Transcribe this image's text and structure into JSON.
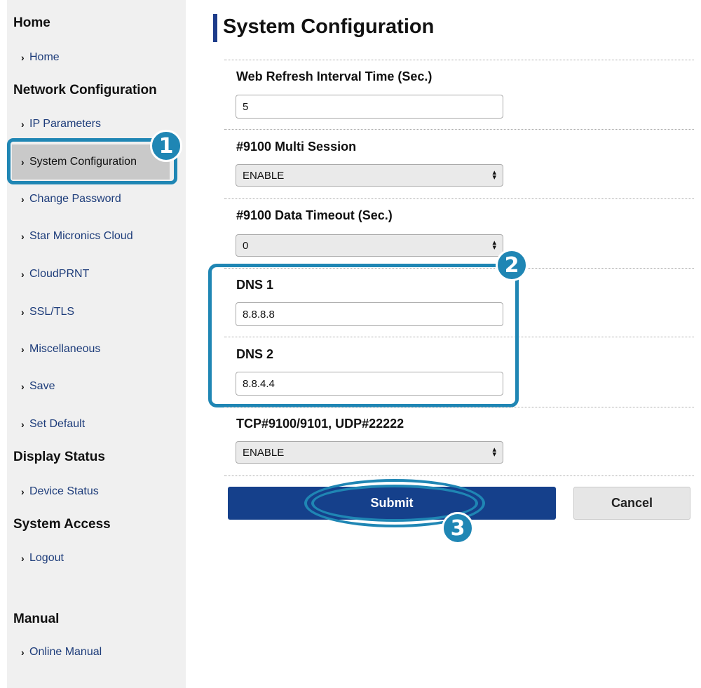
{
  "sidebar": {
    "sections": [
      {
        "heading": "Home",
        "items": [
          {
            "label": "Home"
          }
        ]
      },
      {
        "heading": "Network Configuration",
        "items": [
          {
            "label": "IP Parameters"
          },
          {
            "label": "System Configuration"
          },
          {
            "label": "Change Password"
          },
          {
            "label": "Star Micronics Cloud"
          },
          {
            "label": "CloudPRNT"
          },
          {
            "label": "SSL/TLS"
          },
          {
            "label": "Miscellaneous"
          },
          {
            "label": "Save"
          },
          {
            "label": "Set Default"
          }
        ]
      },
      {
        "heading": "Display Status",
        "items": [
          {
            "label": "Device Status"
          }
        ]
      },
      {
        "heading": "System Access",
        "items": [
          {
            "label": "Logout"
          }
        ]
      },
      {
        "heading": "Manual",
        "items": [
          {
            "label": "Online Manual"
          }
        ]
      }
    ],
    "active_item": "System Configuration"
  },
  "main": {
    "title": "System Configuration",
    "fields": [
      {
        "label": "Web Refresh Interval Time (Sec.)",
        "type": "input",
        "value": "5"
      },
      {
        "label": "#9100 Multi Session",
        "type": "select",
        "value": "ENABLE"
      },
      {
        "label": "#9100 Data Timeout (Sec.)",
        "type": "select",
        "value": "0"
      },
      {
        "label": "DNS 1",
        "type": "input",
        "value": "8.8.8.8"
      },
      {
        "label": "DNS 2",
        "type": "input",
        "value": "8.8.4.4"
      },
      {
        "label": "TCP#9100/9101, UDP#22222",
        "type": "select",
        "value": "ENABLE"
      }
    ],
    "submit_label": "Submit",
    "cancel_label": "Cancel"
  },
  "annotations": {
    "step1": "1",
    "step2": "2",
    "step3": "3",
    "color": "#1f86b4"
  },
  "colors": {
    "primary_button": "#15408b",
    "sidebar_bg": "#f0f0f0",
    "active_item_bg": "#c9c9c9",
    "link": "#1d3c7a"
  }
}
